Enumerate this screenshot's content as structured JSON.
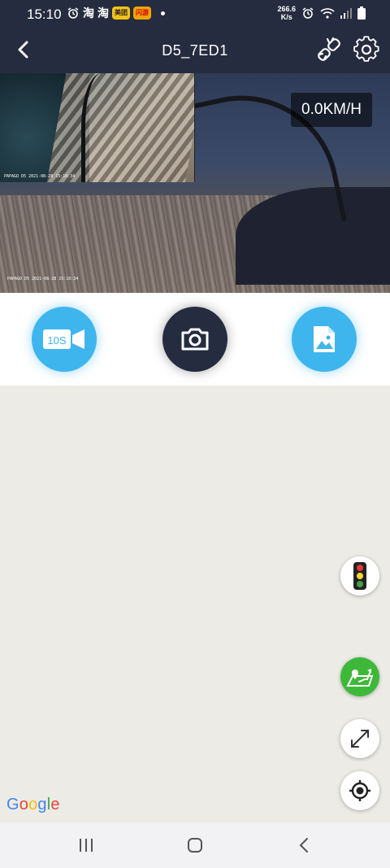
{
  "status_bar": {
    "time": "15:10",
    "badges": [
      {
        "text": "淘",
        "color": "#ffffff"
      },
      {
        "text": "淘",
        "color": "#ffffff"
      },
      {
        "text": "美团",
        "color": "#f3c21a"
      },
      {
        "text": "闪游",
        "color": "#f0a500"
      }
    ],
    "net_speed_value": "266.6",
    "net_speed_unit": "K/s"
  },
  "header": {
    "title": "D5_7ED1"
  },
  "camera": {
    "speed": "0.0KM/H",
    "pip_stamp": "PAPAGO D5 2021-08-28 15:10:34",
    "main_stamp": "PAPAGO D5 2021-08-28 15:10:34"
  },
  "controls": {
    "video_label": "10S"
  },
  "map": {
    "logo_letters": [
      {
        "ch": "G",
        "color": "#4285F4"
      },
      {
        "ch": "o",
        "color": "#EA4335"
      },
      {
        "ch": "o",
        "color": "#FBBC05"
      },
      {
        "ch": "g",
        "color": "#4285F4"
      },
      {
        "ch": "l",
        "color": "#34A853"
      },
      {
        "ch": "e",
        "color": "#EA4335"
      }
    ]
  },
  "colors": {
    "header_bg": "#262c3f",
    "accent_blue": "#3fb5ee",
    "route_green": "#3eb839",
    "map_bg": "#ecebe5"
  },
  "icons": {
    "back": "chevron-left-icon",
    "link": "link-broken-icon",
    "settings": "gear-icon",
    "video": "video-camera-icon",
    "photo": "camera-icon",
    "gallery": "image-file-icon",
    "traffic": "traffic-light-icon",
    "route": "route-map-icon",
    "expand": "expand-arrows-icon",
    "locate": "crosshair-icon"
  }
}
